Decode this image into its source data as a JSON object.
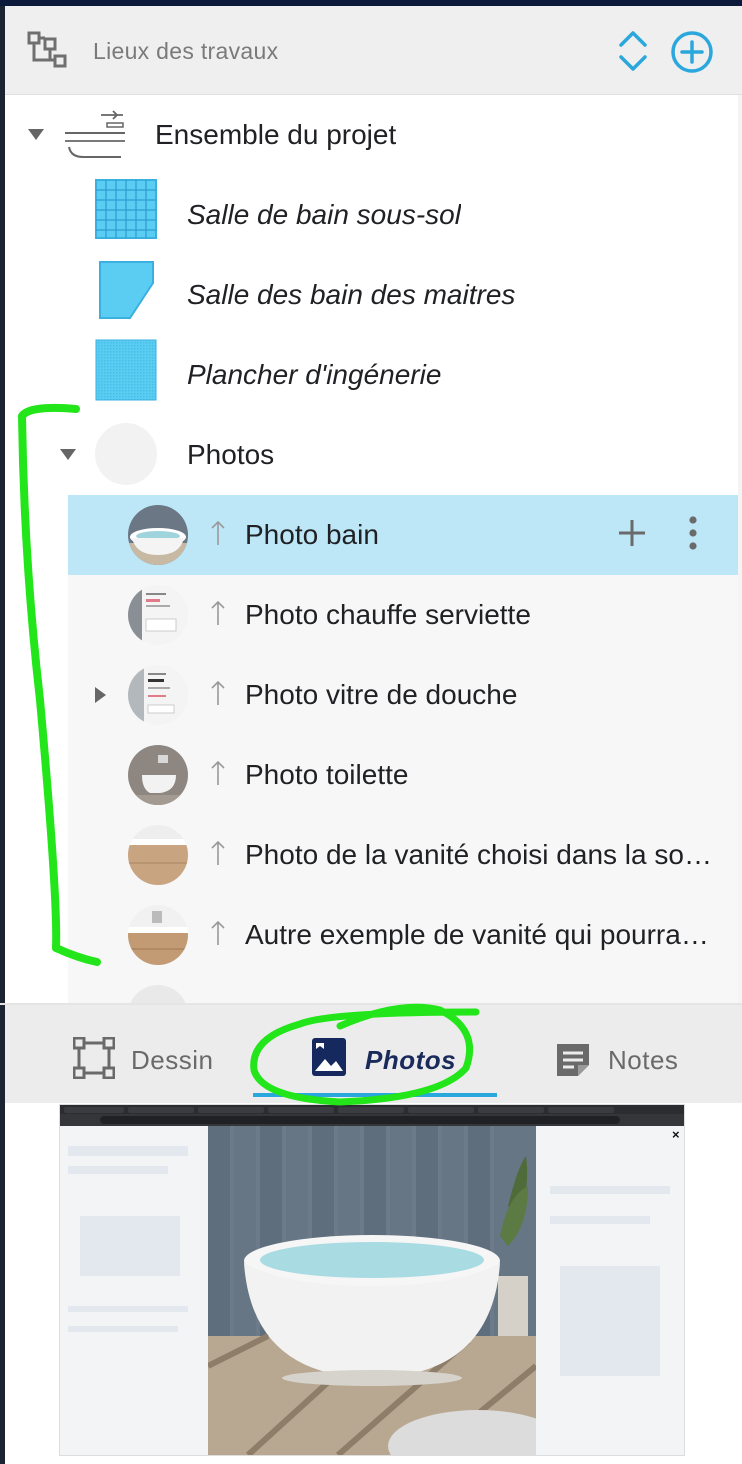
{
  "header": {
    "title": "Lieux des travaux",
    "hierarchy_icon": "hierarchy-icon",
    "sort_icon": "sort-updown-icon",
    "add_icon": "add-circle-icon",
    "accent_color": "#2aa7dc"
  },
  "tree": {
    "root": {
      "label": "Ensemble du projet",
      "icon": "bathtub-icon",
      "expanded": true
    },
    "items": [
      {
        "label": "Salle de bain sous-sol",
        "icon": "tile-grid-icon"
      },
      {
        "label": "Salle des bain des maitres",
        "icon": "floor-shape-icon"
      },
      {
        "label": "Plancher d'ingénerie",
        "icon": "floor-pattern-icon"
      }
    ],
    "photos_group": {
      "label": "Photos",
      "expanded": true,
      "items": [
        {
          "label": "Photo bain",
          "selected": true,
          "thumb": "bathtub-thumb"
        },
        {
          "label": "Photo chauffe serviette",
          "selected": false,
          "thumb": "screenshot-thumb"
        },
        {
          "label": "Photo vitre de douche",
          "selected": false,
          "thumb": "screenshot-thumb",
          "has_children": true
        },
        {
          "label": "Photo toilette",
          "selected": false,
          "thumb": "toilet-thumb"
        },
        {
          "label": "Photo de la vanité choisi dans la so…",
          "selected": false,
          "thumb": "vanity-thumb"
        },
        {
          "label": "Autre exemple de vanité qui pourrait…",
          "selected": false,
          "thumb": "vanity-thumb"
        }
      ]
    },
    "selected_row_actions": {
      "add_icon": "plus-icon",
      "more_icon": "more-vert-icon"
    }
  },
  "tabs": [
    {
      "label": "Dessin",
      "icon": "drawing-frame-icon",
      "active": false
    },
    {
      "label": "Photos",
      "icon": "image-icon",
      "active": true
    },
    {
      "label": "Notes",
      "icon": "notes-icon",
      "active": false
    }
  ],
  "preview": {
    "close_label": "×"
  },
  "colors": {
    "selected_row": "#bde7f7",
    "annotation_green": "#22e51a",
    "tile_blue": "#5bcdf2",
    "active_tab_text": "#1a2a5a"
  }
}
